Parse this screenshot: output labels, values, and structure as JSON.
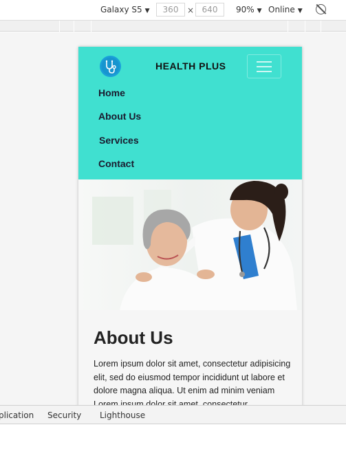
{
  "device_toolbar": {
    "device": "Galaxy S5",
    "width": "360",
    "times": "×",
    "height": "640",
    "zoom": "90%",
    "network": "Online",
    "caret": "▼",
    "rotate_icon": "rotate-icon"
  },
  "site": {
    "brand": "HEALTH PLUS",
    "logo_icon": "stethoscope-icon",
    "menu_icon": "hamburger-menu-icon",
    "accent_color": "#40e0d0",
    "nav": [
      "Home",
      "About Us",
      "Services",
      "Contact"
    ],
    "hero_image": "doctor-with-senior-patient-photo",
    "about": {
      "title": "About Us",
      "text": "Lorem ipsum dolor sit amet, consectetur adipisicing elit, sed do eiusmod tempor incididunt ut labore et dolore magna aliqua. Ut enim ad minim veniam Lorem ipsum dolor sit amet, consectetur"
    }
  },
  "devtools_tabs": [
    "plication",
    "Security",
    "Lighthouse"
  ]
}
